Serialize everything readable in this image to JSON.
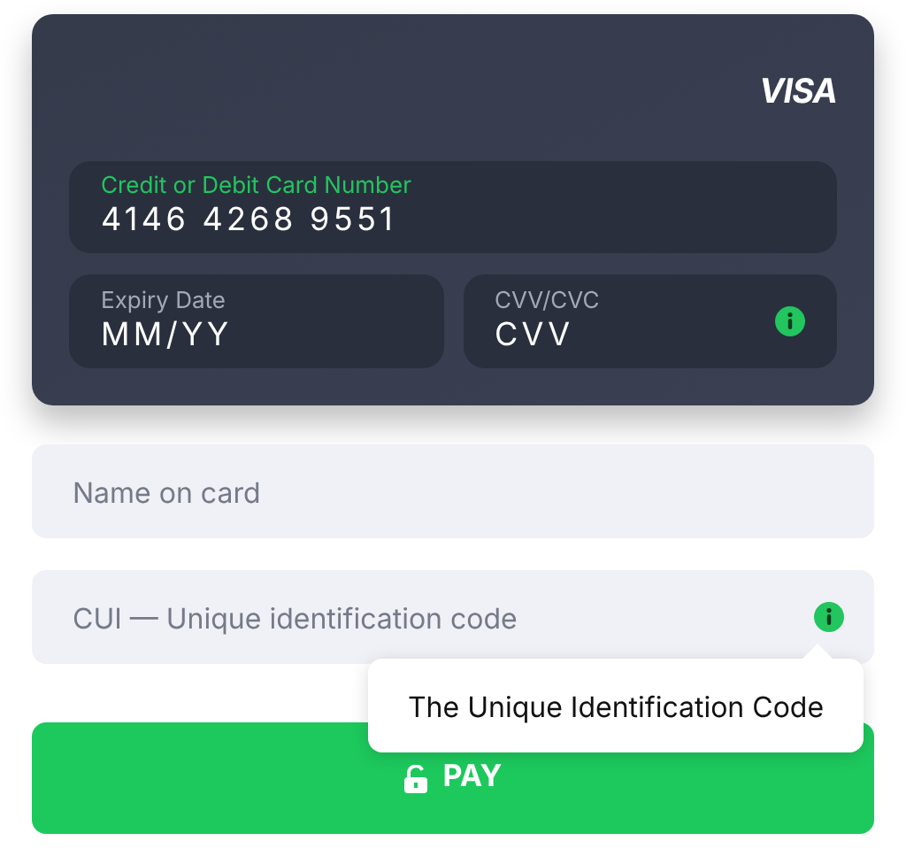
{
  "card": {
    "brand": "VISA",
    "number_field": {
      "label": "Credit or Debit Card Number",
      "value": "4146 4268 9551",
      "focused": true
    },
    "expiry_field": {
      "label": "Expiry Date",
      "value": "MM/YY",
      "focused": false
    },
    "cvv_field": {
      "label": "CVV/CVC",
      "value": "CVV",
      "focused": false
    }
  },
  "name_field": {
    "placeholder": "Name on card"
  },
  "cui_field": {
    "placeholder": "CUI — Unique identification code"
  },
  "tooltip": {
    "text": "The Unique Identification Code"
  },
  "pay_button": {
    "label": "PAY"
  }
}
